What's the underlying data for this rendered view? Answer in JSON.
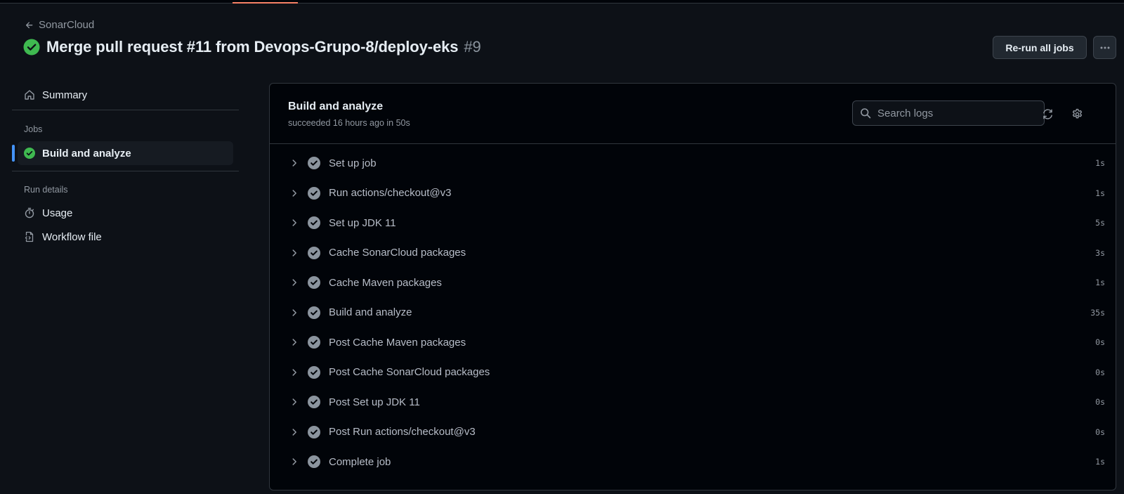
{
  "breadcrumb": {
    "back_label": "SonarCloud"
  },
  "header": {
    "title": "Merge pull request #11 from Devops-Grupo-8/deploy-eks",
    "run_number": "#9",
    "rerun_label": "Re-run all jobs"
  },
  "sidebar": {
    "summary_label": "Summary",
    "jobs_heading": "Jobs",
    "job_label": "Build and analyze",
    "run_details_heading": "Run details",
    "usage_label": "Usage",
    "workflow_label": "Workflow file"
  },
  "job": {
    "title": "Build and analyze",
    "subtitle": "succeeded 16 hours ago in 50s",
    "search_placeholder": "Search logs",
    "steps": [
      {
        "name": "Set up job",
        "duration": "1s"
      },
      {
        "name": "Run actions/checkout@v3",
        "duration": "1s"
      },
      {
        "name": "Set up JDK 11",
        "duration": "5s"
      },
      {
        "name": "Cache SonarCloud packages",
        "duration": "3s"
      },
      {
        "name": "Cache Maven packages",
        "duration": "1s"
      },
      {
        "name": "Build and analyze",
        "duration": "35s"
      },
      {
        "name": "Post Cache Maven packages",
        "duration": "0s"
      },
      {
        "name": "Post Cache SonarCloud packages",
        "duration": "0s"
      },
      {
        "name": "Post Set up JDK 11",
        "duration": "0s"
      },
      {
        "name": "Post Run actions/checkout@v3",
        "duration": "0s"
      },
      {
        "name": "Complete job",
        "duration": "1s"
      }
    ]
  },
  "colors": {
    "background": "#0d1117",
    "success": "#3fb950",
    "accent": "#4493f8",
    "step_check": "#8b949e"
  }
}
